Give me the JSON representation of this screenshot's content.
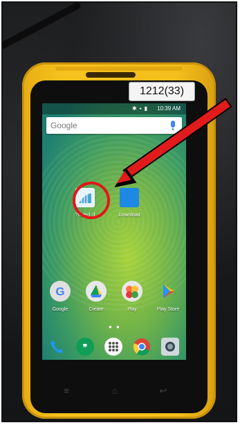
{
  "device_tag": "1212(33)",
  "status_bar": {
    "time": "10:39 AM",
    "icons": [
      "bluetooth-icon",
      "signal-icon",
      "battery-icon"
    ]
  },
  "search_widget": {
    "brand": "Google"
  },
  "home_apps": [
    {
      "label": "?nated  ll",
      "icon": "app-icon-highlighted",
      "color": "#4aa6d8"
    },
    {
      "label": "Download",
      "icon": "folder-icon",
      "color": "#1e88e5"
    }
  ],
  "row_apps": [
    {
      "label": "Google",
      "icon": "google-icon"
    },
    {
      "label": "Create",
      "icon": "drive-icon"
    },
    {
      "label": "Play",
      "icon": "play-folder-icon"
    },
    {
      "label": "Play Store",
      "icon": "play-store-icon"
    }
  ],
  "page_indicator": "● ●",
  "dock": [
    {
      "icon": "phone-icon",
      "color": "#2196f3"
    },
    {
      "icon": "hangouts-icon",
      "color": "#0f9d58"
    },
    {
      "icon": "app-drawer-icon",
      "color": "#ffffff"
    },
    {
      "icon": "chrome-icon",
      "color": "#db4437"
    },
    {
      "icon": "camera-icon",
      "color": "#cfd8dc"
    }
  ],
  "colors": {
    "phone_body": "#f4bf1c",
    "annotation_red": "#e11b1b"
  }
}
